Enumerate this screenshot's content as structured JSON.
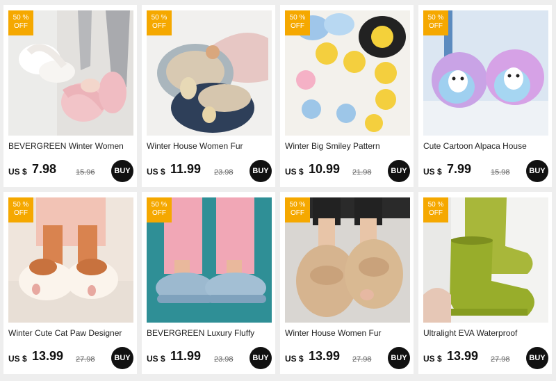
{
  "products": [
    {
      "badge_pct": "50 %",
      "badge_off": "OFF",
      "title": "BEVERGREEN Winter Women",
      "currency": "US $",
      "price": "7.98",
      "old_price": "15.96",
      "buy": "BUY",
      "image": "fluffy-pink-slippers"
    },
    {
      "badge_pct": "50 %",
      "badge_off": "OFF",
      "title": "Winter House Women Fur",
      "currency": "US $",
      "price": "11.99",
      "old_price": "23.98",
      "buy": "BUY",
      "image": "squirrel-slippers"
    },
    {
      "badge_pct": "50 %",
      "badge_off": "OFF",
      "title": "Winter Big Smiley Pattern",
      "currency": "US $",
      "price": "10.99",
      "old_price": "21.98",
      "buy": "BUY",
      "image": "smiley-slippers"
    },
    {
      "badge_pct": "50 %",
      "badge_off": "OFF",
      "title": "Cute Cartoon Alpaca House",
      "currency": "US $",
      "price": "7.99",
      "old_price": "15.98",
      "buy": "BUY",
      "image": "alpaca-slippers"
    },
    {
      "badge_pct": "50 %",
      "badge_off": "OFF",
      "title": "Winter Cute Cat Paw Designer",
      "currency": "US $",
      "price": "13.99",
      "old_price": "27.98",
      "buy": "BUY",
      "image": "cat-paw-slippers"
    },
    {
      "badge_pct": "50 %",
      "badge_off": "OFF",
      "title": "BEVERGREEN Luxury Fluffy",
      "currency": "US $",
      "price": "11.99",
      "old_price": "23.98",
      "buy": "BUY",
      "image": "blue-fluffy-slides"
    },
    {
      "badge_pct": "50 %",
      "badge_off": "OFF",
      "title": "Winter House Women Fur",
      "currency": "US $",
      "price": "13.99",
      "old_price": "27.98",
      "buy": "BUY",
      "image": "beige-fur-slippers"
    },
    {
      "badge_pct": "50 %",
      "badge_off": "OFF",
      "title": "Ultralight EVA Waterproof",
      "currency": "US $",
      "price": "13.99",
      "old_price": "27.98",
      "buy": "BUY",
      "image": "green-rain-boots"
    }
  ],
  "colors": {
    "badge": "#f5a800",
    "buy_button": "#111111",
    "background": "#eeeeee"
  }
}
